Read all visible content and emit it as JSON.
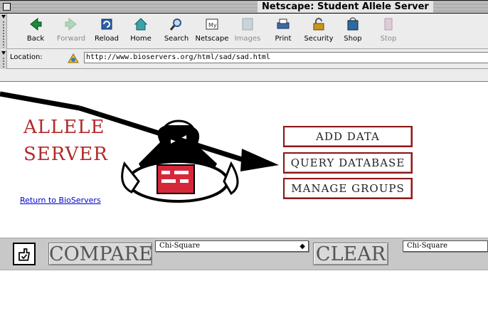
{
  "window": {
    "title": "Netscape: Student Allele Server"
  },
  "toolbar": {
    "buttons": [
      {
        "label": "Back",
        "icon": "back-arrow-icon",
        "enabled": true
      },
      {
        "label": "Forward",
        "icon": "forward-arrow-icon",
        "enabled": false
      },
      {
        "label": "Reload",
        "icon": "reload-icon",
        "enabled": true
      },
      {
        "label": "Home",
        "icon": "home-icon",
        "enabled": true
      },
      {
        "label": "Search",
        "icon": "search-icon",
        "enabled": true
      },
      {
        "label": "Netscape",
        "icon": "netscape-icon",
        "enabled": true
      },
      {
        "label": "Images",
        "icon": "images-icon",
        "enabled": false
      },
      {
        "label": "Print",
        "icon": "print-icon",
        "enabled": true
      },
      {
        "label": "Security",
        "icon": "security-lock-icon",
        "enabled": true
      },
      {
        "label": "Shop",
        "icon": "shop-icon",
        "enabled": true
      },
      {
        "label": "Stop",
        "icon": "stop-icon",
        "enabled": false
      }
    ],
    "location_label": "Location:",
    "url": "http://www.bioservers.org/html/sad/sad.html"
  },
  "page": {
    "logo_line1": "ALLELE",
    "logo_line2": "SERVER",
    "menu": {
      "add_data": "ADD DATA",
      "query_database": "QUERY DATABASE",
      "manage_groups": "MANAGE GROUPS"
    },
    "return_link": "Return to BioServers",
    "compare_label": "COMPARE",
    "clear_label": "CLEAR",
    "select_left": "Chi-Square",
    "select_right": "Chi-Square"
  },
  "colors": {
    "accent": "#8b1a1a",
    "logo": "#b12a2a",
    "link": "#0000cc"
  }
}
